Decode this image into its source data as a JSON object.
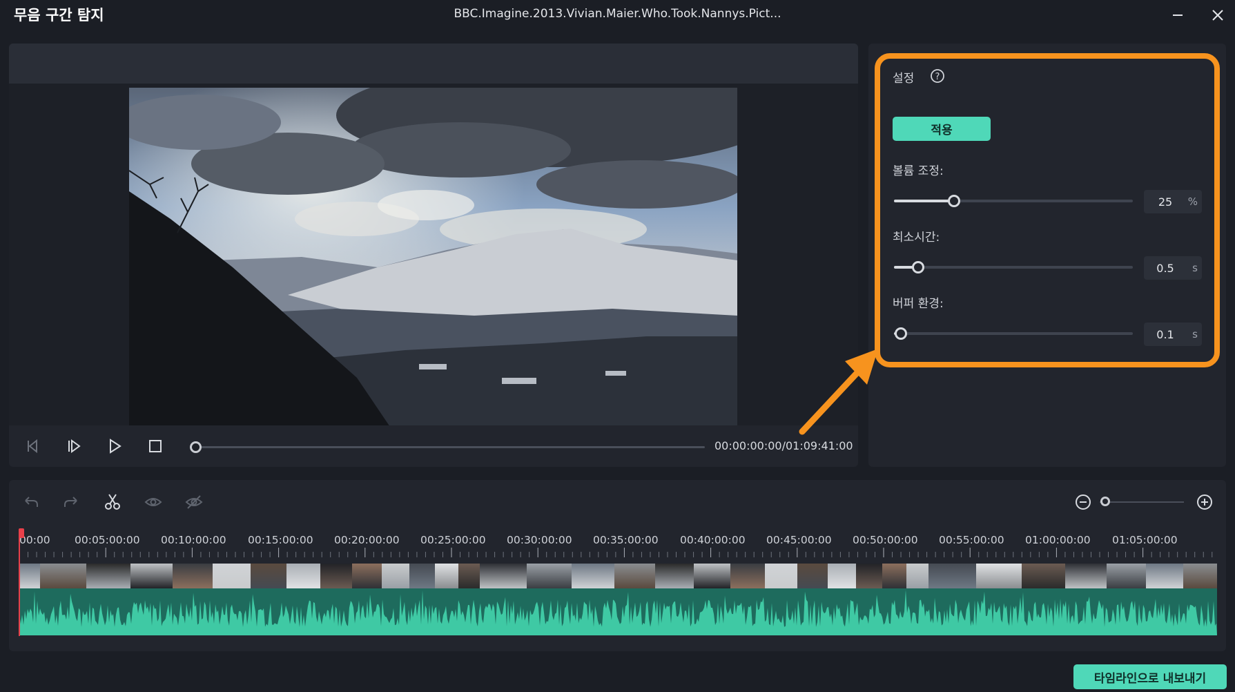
{
  "app": {
    "title": "무음 구간 탐지",
    "file_name": "BBC.Imagine.2013.Vivian.Maier.Who.Took.Nannys.Pict..."
  },
  "player": {
    "time_display": "00:00:00:00/01:09:41:00",
    "progress_fraction": 0.0
  },
  "settings": {
    "title": "설정",
    "help_icon": "question-circle-icon",
    "apply_label": "적용",
    "volume": {
      "label": "볼륨 조정:",
      "value": "25",
      "unit": "%",
      "fraction": 0.25
    },
    "min_time": {
      "label": "최소시간:",
      "value": "0.5",
      "unit": "s",
      "fraction": 0.1
    },
    "buffer": {
      "label": "버퍼 환경:",
      "value": "0.1",
      "unit": "s",
      "fraction": 0.03
    }
  },
  "timeline": {
    "ruler_labels": [
      "00:00",
      "00:05:00:00",
      "00:10:00:00",
      "00:15:00:00",
      "00:20:00:00",
      "00:25:00:00",
      "00:30:00:00",
      "00:35:00:00",
      "00:40:00:00",
      "00:45:00:00",
      "00:50:00:00",
      "00:55:00:00",
      "01:00:00:00",
      "01:05:00:00"
    ],
    "zoom_fraction": 0.0
  },
  "export_label": "타임라인으로 내보내기",
  "colors": {
    "accent": "#4fd8b8",
    "highlight": "#f7931e",
    "waveform": "#3fc9a4",
    "playhead": "#e8404a"
  }
}
